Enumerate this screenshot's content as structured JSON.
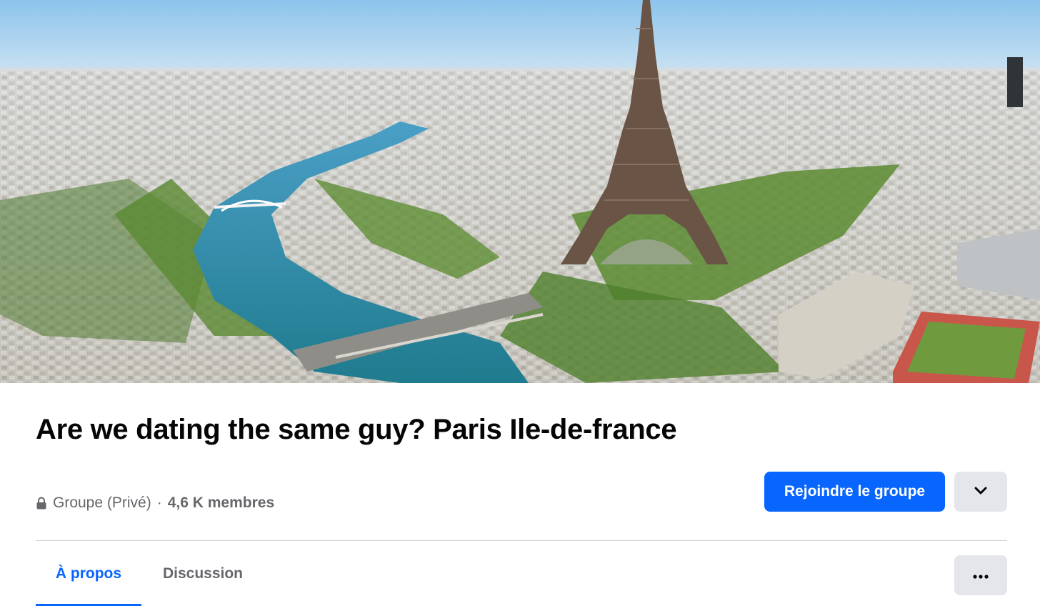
{
  "cover": {
    "icon": "cover-photo"
  },
  "group": {
    "title": "Are we dating the same guy? Paris Ile-de-france",
    "privacy_label": "Groupe (Privé)",
    "separator": "·",
    "members_label": "4,6 K membres",
    "privacy_icon": "lock-icon"
  },
  "actions": {
    "join_label": "Rejoindre le groupe",
    "dropdown_icon": "chevron-down-icon",
    "more_icon": "more-horizontal-icon"
  },
  "tabs": [
    {
      "label": "À propos",
      "active": true
    },
    {
      "label": "Discussion",
      "active": false
    }
  ],
  "colors": {
    "accent": "#0866ff",
    "secondary_text": "#65676b",
    "button_gray": "#e4e6eb"
  }
}
